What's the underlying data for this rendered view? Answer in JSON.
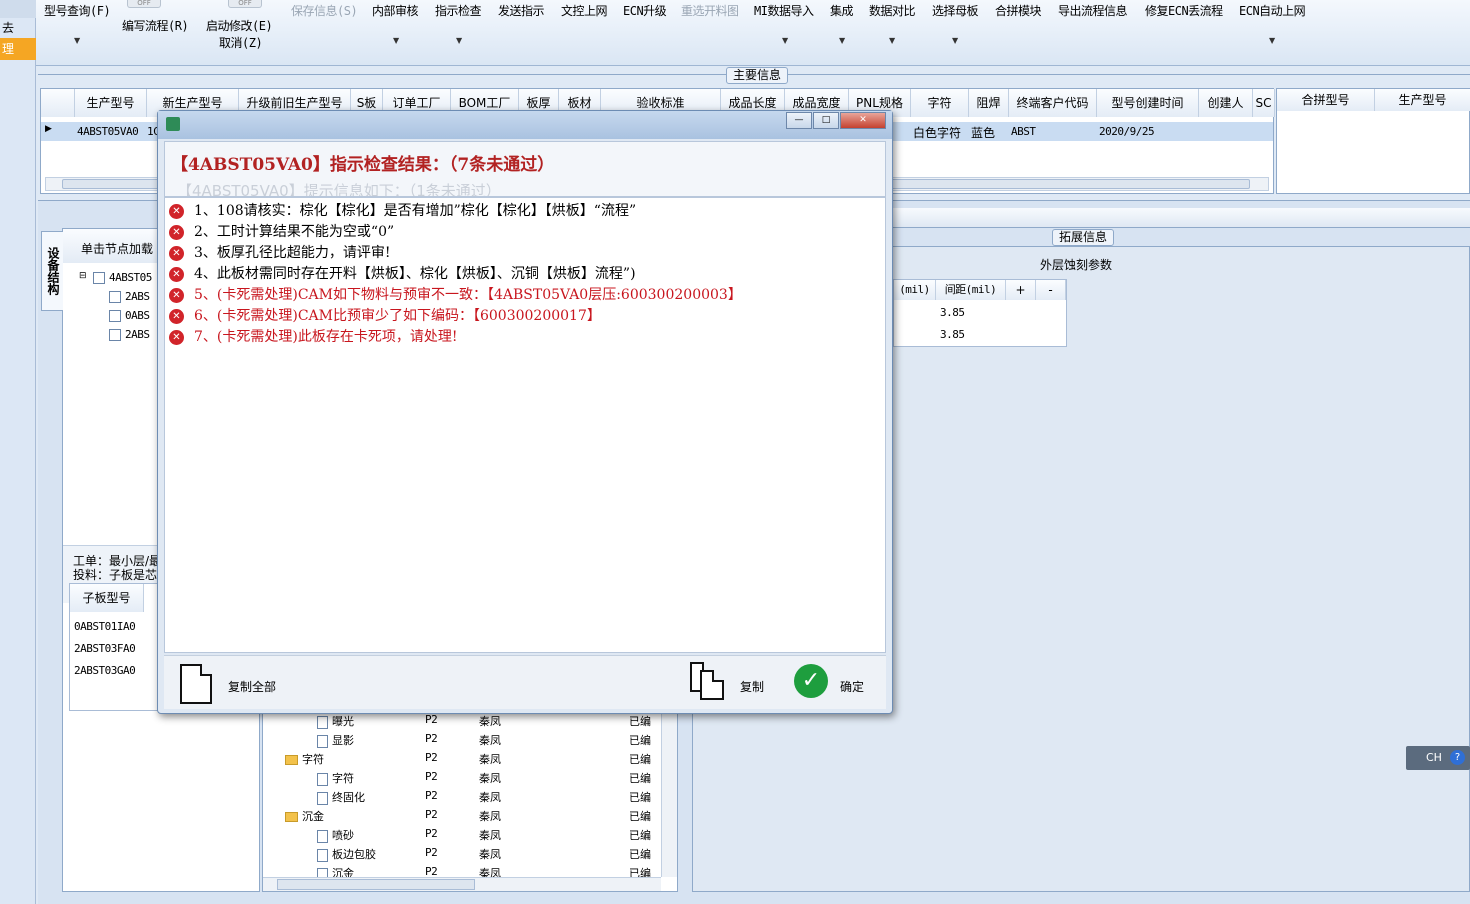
{
  "ribbon": {
    "left_strip": [
      "去",
      "理"
    ],
    "buttons": [
      {
        "label": "型号查询(F)",
        "enabled": true
      },
      {
        "label": "编写流程(R)",
        "enabled": true
      },
      {
        "label": "启动修改(E)",
        "enabled": true
      },
      {
        "label": "取消(Z)",
        "enabled": true
      },
      {
        "label": "保存信息(S)",
        "enabled": false
      },
      {
        "label": "内部审核",
        "enabled": true
      },
      {
        "label": "指示检查",
        "enabled": true
      },
      {
        "label": "发送指示",
        "enabled": true
      },
      {
        "label": "文控上网",
        "enabled": true
      },
      {
        "label": "ECN升级",
        "enabled": true
      },
      {
        "label": "重选开料图",
        "enabled": false
      },
      {
        "label": "MI数据导入",
        "enabled": true
      },
      {
        "label": "集成",
        "enabled": true
      },
      {
        "label": "数据对比",
        "enabled": true
      },
      {
        "label": "选择母板",
        "enabled": true
      },
      {
        "label": "合拼模块",
        "enabled": true
      },
      {
        "label": "导出流程信息",
        "enabled": true
      },
      {
        "label": "修复ECN丢流程",
        "enabled": true
      },
      {
        "label": "ECN自动上网",
        "enabled": true
      }
    ],
    "toggle_text": "OFF"
  },
  "main_info": {
    "legend": "主要信息",
    "columns": [
      "生产型号",
      "新生产型号",
      "升级前旧生产型号",
      "S板",
      "订单工厂",
      "BOM工厂",
      "板厚",
      "板材",
      "验收标准",
      "成品长度",
      "成品宽度",
      "PNL规格",
      "字符",
      "阻焊",
      "终端客户代码",
      "型号创建时间",
      "创建人",
      "SC"
    ],
    "row": {
      "production_model": "4ABST05VA0",
      "new_model_partial": "1C",
      "char": "白色字符",
      "solder_mask": "蓝色",
      "customer_code": "ABST",
      "created": "2020/9/25"
    },
    "side_columns": [
      "合拼型号",
      "生产型号"
    ]
  },
  "left_pane": {
    "tab": "设备结构",
    "load_hint": "单击节点加载",
    "tree": [
      "4ABST05",
      "2ABS",
      "0ABS",
      "2ABS"
    ],
    "work_order": "工单：最小层/最",
    "feed": "投料：子板是芯",
    "sub_board_header": "子板型号",
    "sub_boards": [
      "0ABST01IA0",
      "2ABST03FA0",
      "2ABST03GA0"
    ]
  },
  "flow_tree": {
    "rows": [
      {
        "name": "曝光",
        "type": "file",
        "p": "P2",
        "who": "秦凤",
        "status": "已编"
      },
      {
        "name": "显影",
        "type": "file",
        "p": "P2",
        "who": "秦凤",
        "status": "已编"
      },
      {
        "name": "字符",
        "type": "folder",
        "p": "P2",
        "who": "秦凤",
        "status": "已编"
      },
      {
        "name": "字符",
        "type": "file",
        "p": "P2",
        "who": "秦凤",
        "status": "已编"
      },
      {
        "name": "终固化",
        "type": "file",
        "p": "P2",
        "who": "秦凤",
        "status": "已编"
      },
      {
        "name": "沉金",
        "type": "folder",
        "p": "P2",
        "who": "秦凤",
        "status": "已编"
      },
      {
        "name": "喷砂",
        "type": "file",
        "p": "P2",
        "who": "秦凤",
        "status": "已编"
      },
      {
        "name": "板边包胶",
        "type": "file",
        "p": "P2",
        "who": "秦凤",
        "status": "已编"
      },
      {
        "name": "沉金",
        "type": "file",
        "p": "P2",
        "who": "秦凤",
        "status": "已编"
      }
    ]
  },
  "ext_info": {
    "legend": "拓展信息",
    "section_title": "外层蚀刻参数",
    "columns": [
      "(mil)",
      "间距(mil)",
      "+",
      "-"
    ],
    "values": [
      "3.85",
      "3.85"
    ]
  },
  "dialog": {
    "title": "【4ABST05VA0】指示检查结果：（7条未通过）",
    "ghost_line": "【4ABST05VA0】提示信息如下：（1条未通过）",
    "items": [
      {
        "text": "1、108请核实：棕化【棕化】是否有增加”棕化【棕化】【烘板】“流程”",
        "severity": "normal"
      },
      {
        "text": "2、工时计算结果不能为空或“0”",
        "severity": "normal"
      },
      {
        "text": "3、板厚孔径比超能力，请评审!",
        "severity": "normal"
      },
      {
        "text": "4、此板材需同时存在开料【烘板】、棕化【烘板】、沉铜【烘板】流程”)",
        "severity": "normal"
      },
      {
        "text": "5、(卡死需处理)CAM如下物料与预审不一致：【4ABST05VA0层压:600300200003】",
        "severity": "fatal"
      },
      {
        "text": "6、(卡死需处理)CAM比预审少了如下编码：【600300200017】",
        "severity": "fatal"
      },
      {
        "text": "7、(卡死需处理)此板存在卡死项，请处理!",
        "severity": "fatal"
      }
    ],
    "copy_all_label": "复制全部",
    "copy_label": "复制",
    "ok_label": "确定",
    "colors": {
      "fatal": "#c8161e",
      "title": "#b22222"
    }
  },
  "lang": {
    "label": "CH",
    "help": "?"
  }
}
